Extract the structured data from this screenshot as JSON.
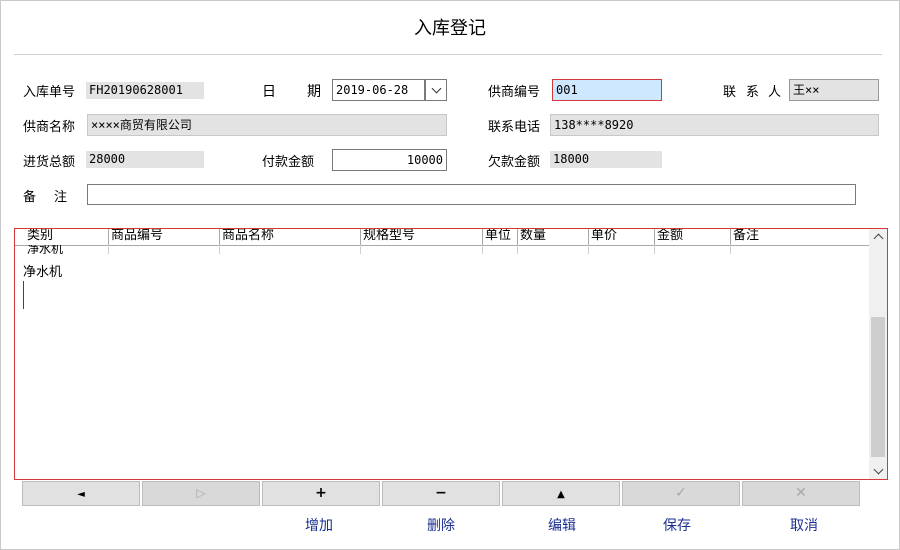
{
  "window": {
    "title": "入库登记"
  },
  "form": {
    "order_no_label": "入库单号",
    "order_no": "FH20190628001",
    "date_label_1": "日",
    "date_label_2": "期",
    "date": "2019-06-28",
    "supplier_code_label": "供商编号",
    "supplier_code": "001",
    "contact_label_1": "联",
    "contact_label_2": "系",
    "contact_label_3": "人",
    "contact": "王××",
    "supplier_name_label": "供商名称",
    "supplier_name": "××××商贸有限公司",
    "phone_label": "联系电话",
    "phone": "138****8920",
    "total_label": "进货总额",
    "total": "28000",
    "paid_label": "付款金额",
    "paid": "10000",
    "debt_label": "欠款金额",
    "debt": "18000",
    "remark_label_1": "备",
    "remark_label_2": "注",
    "remark": ""
  },
  "grid": {
    "columns": [
      "类别",
      "商品编号",
      "商品名称",
      "规格型号",
      "单位",
      "数量",
      "单价",
      "金额",
      "备注"
    ],
    "row": {
      "category": "净水机"
    },
    "editor_text": "净水机"
  },
  "nav": {
    "first": "◄",
    "next": "▷",
    "add": "+",
    "remove": "−",
    "up": "▲",
    "ok": "✓",
    "close": "✕"
  },
  "actions": {
    "add": "增加",
    "delete": "删除",
    "edit": "编辑",
    "save": "保存",
    "cancel": "取消"
  }
}
